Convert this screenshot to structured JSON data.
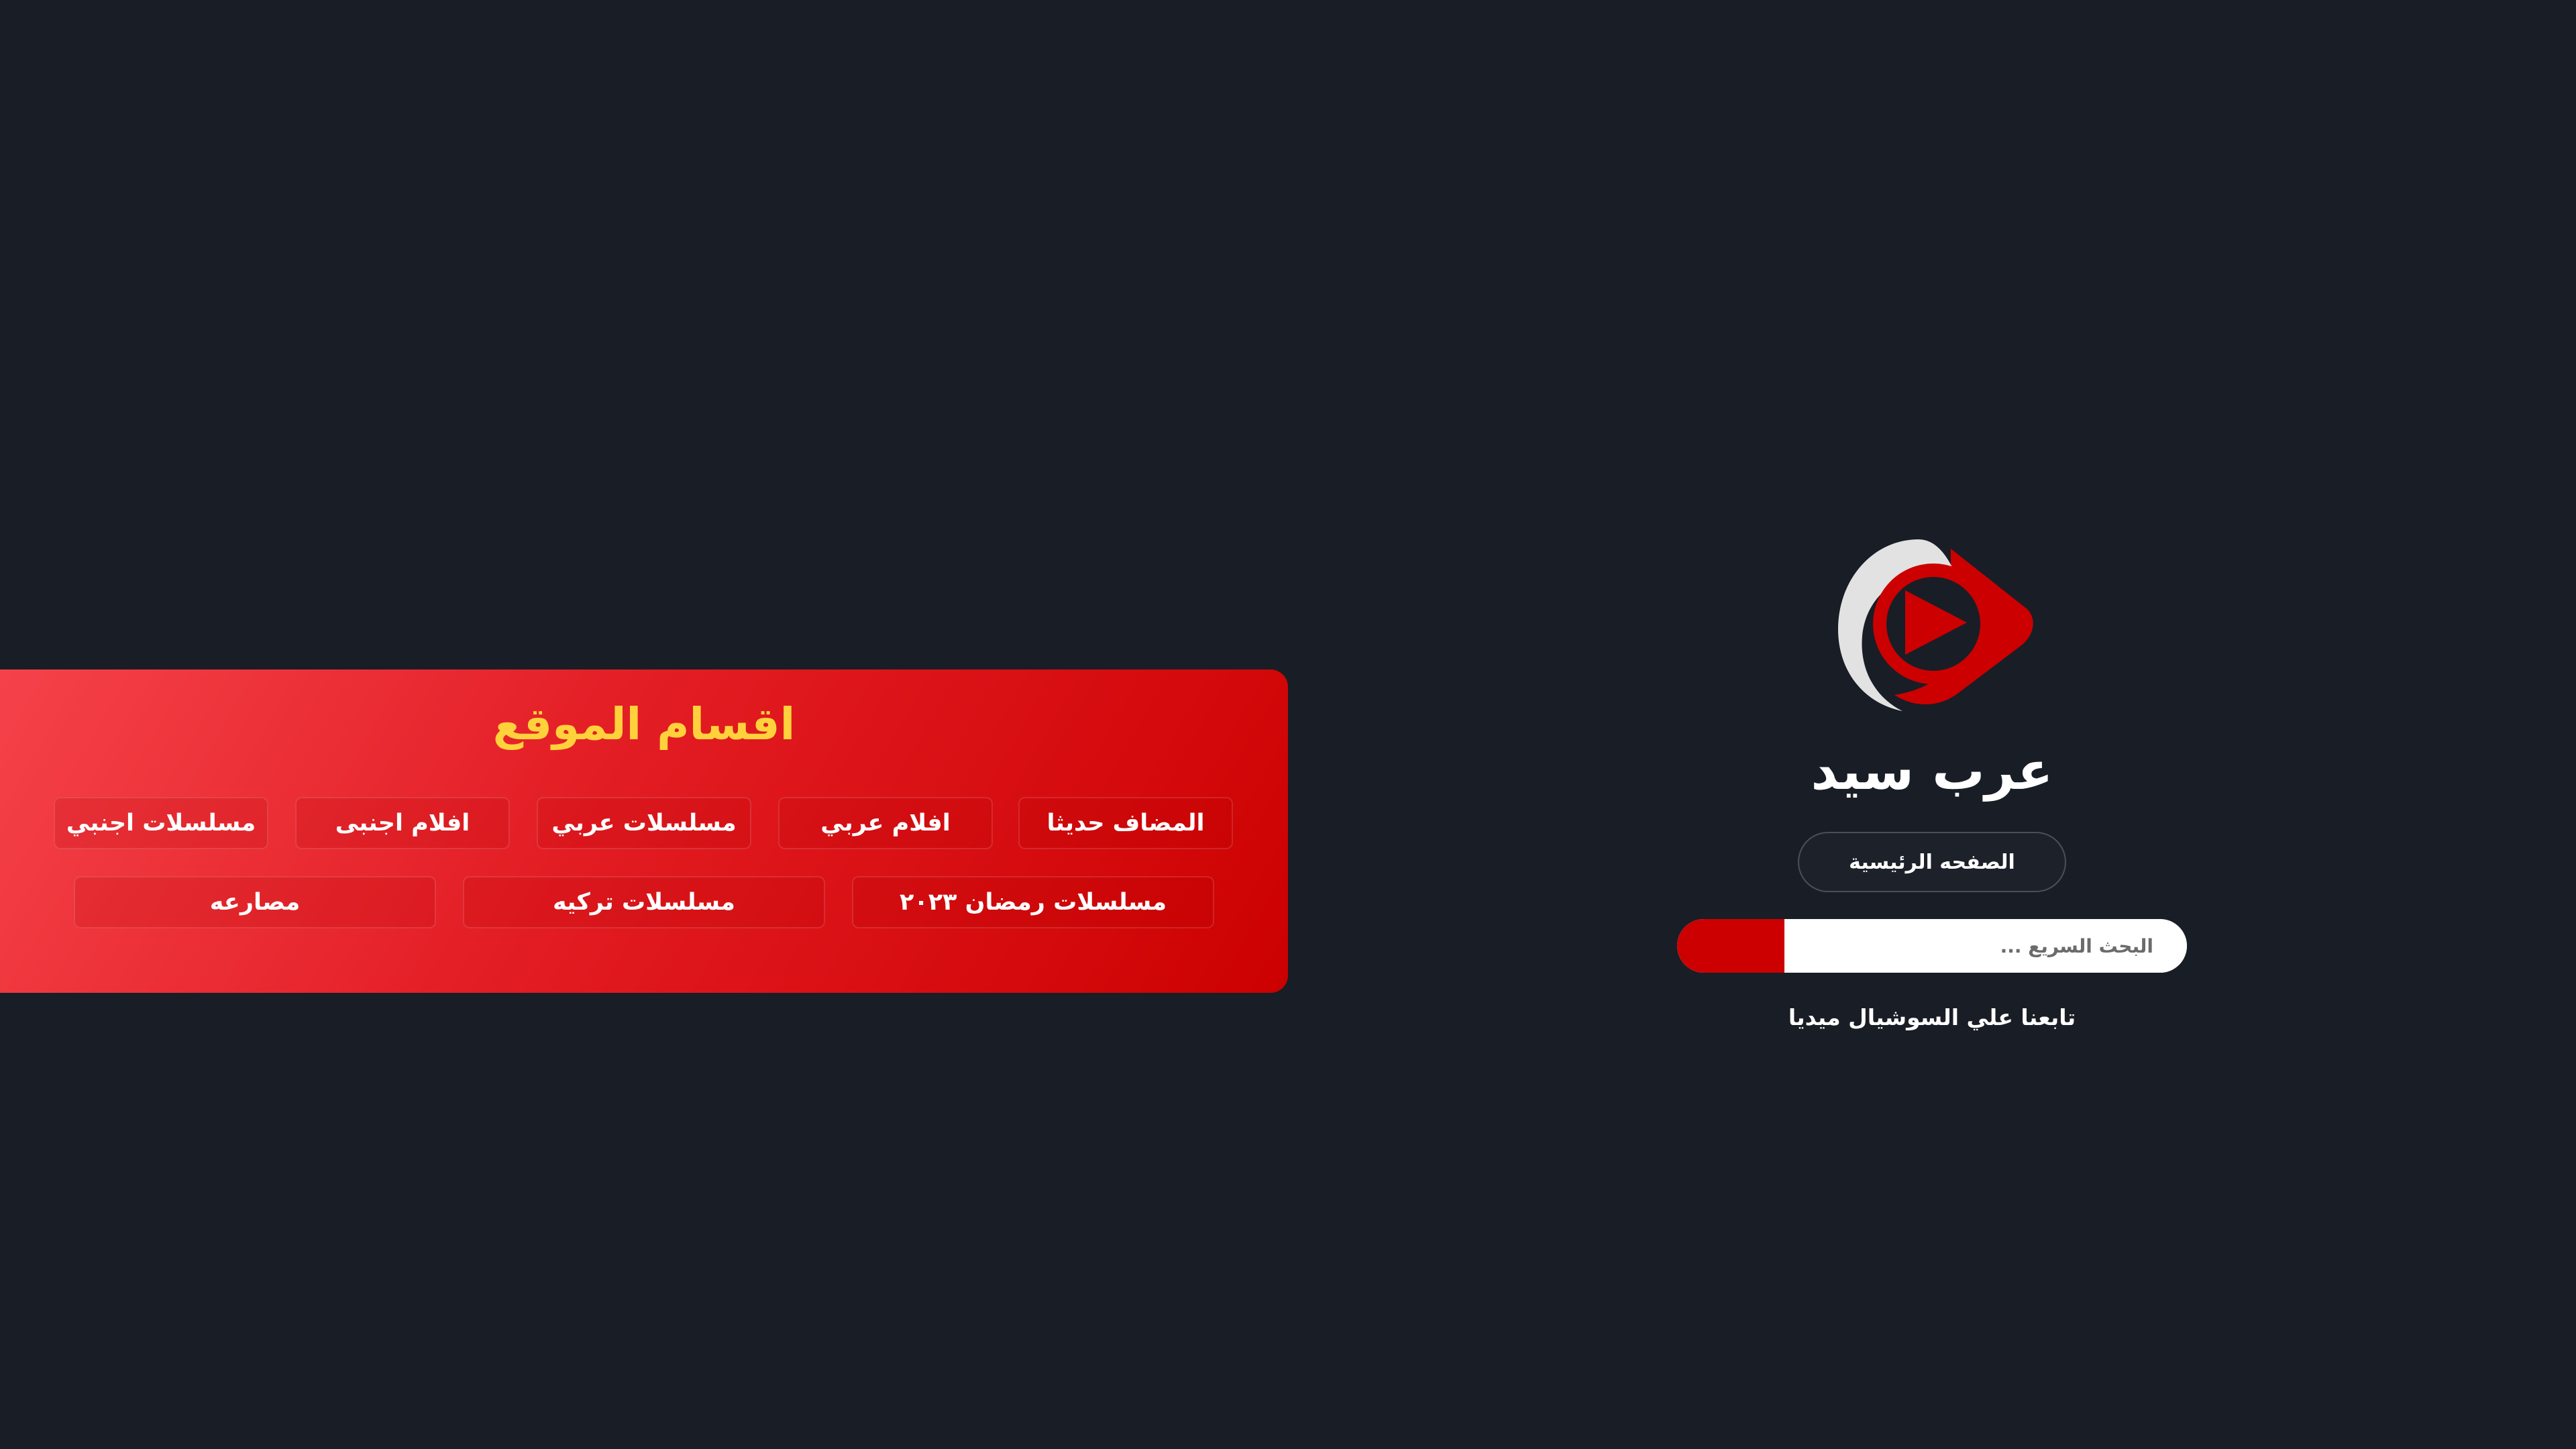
{
  "site": {
    "name": "عرب سيد"
  },
  "nav": {
    "home_label": "الصفحه الرئيسية"
  },
  "search": {
    "placeholder": "البحث السريع ..."
  },
  "social": {
    "label": "تابعنا علي السوشيال ميديا"
  },
  "categories": {
    "title": "اقسام الموقع",
    "items": [
      {
        "label": "المضاف حديثا"
      },
      {
        "label": "افلام عربي"
      },
      {
        "label": "مسلسلات عربي"
      },
      {
        "label": "افلام اجنبى"
      },
      {
        "label": "مسلسلات اجنبي"
      },
      {
        "label": "مسلسلات رمضان ٢٠٢٣"
      },
      {
        "label": "مسلسلات تركيه"
      },
      {
        "label": "مصارعه"
      }
    ]
  },
  "colors": {
    "background": "#191d26",
    "accent_red": "#cc0000",
    "title_yellow": "#ffd23c",
    "logo_grey": "#e2e2e2"
  },
  "icons": {
    "logo": "play-logo-icon",
    "search": "search-button"
  }
}
